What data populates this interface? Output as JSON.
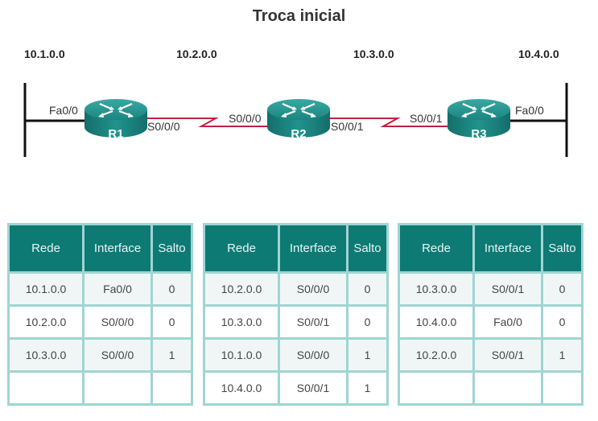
{
  "title": "Troca inicial",
  "networks": [
    "10.1.0.0",
    "10.2.0.0",
    "10.3.0.0",
    "10.4.0.0"
  ],
  "routers": [
    {
      "name": "R1",
      "left_if": "Fa0/0",
      "right_if": "S0/0/0"
    },
    {
      "name": "R2",
      "left_if": "S0/0/0",
      "right_if": "S0/0/1"
    },
    {
      "name": "R3",
      "left_if": "S0/0/1",
      "right_if": "Fa0/0"
    }
  ],
  "colors": {
    "router": "#1f8e8a",
    "serial_link": "#c0213e",
    "table_header": "#0d7a74",
    "table_border": "#9fd5d3"
  },
  "tables": [
    {
      "router": "R1",
      "headers": [
        "Rede",
        "Interface",
        "Salto"
      ],
      "rows": [
        [
          "10.1.0.0",
          "Fa0/0",
          "0"
        ],
        [
          "10.2.0.0",
          "S0/0/0",
          "0"
        ],
        [
          "10.3.0.0",
          "S0/0/0",
          "1"
        ],
        [
          "",
          "",
          ""
        ]
      ]
    },
    {
      "router": "R2",
      "headers": [
        "Rede",
        "Interface",
        "Salto"
      ],
      "rows": [
        [
          "10.2.0.0",
          "S0/0/0",
          "0"
        ],
        [
          "10.3.0.0",
          "S0/0/1",
          "0"
        ],
        [
          "10.1.0.0",
          "S0/0/0",
          "1"
        ],
        [
          "10.4.0.0",
          "S0/0/1",
          "1"
        ]
      ]
    },
    {
      "router": "R3",
      "headers": [
        "Rede",
        "Interface",
        "Salto"
      ],
      "rows": [
        [
          "10.3.0.0",
          "S0/0/1",
          "0"
        ],
        [
          "10.4.0.0",
          "Fa0/0",
          "0"
        ],
        [
          "10.2.0.0",
          "S0/0/1",
          "1"
        ],
        [
          "",
          "",
          ""
        ]
      ]
    }
  ]
}
